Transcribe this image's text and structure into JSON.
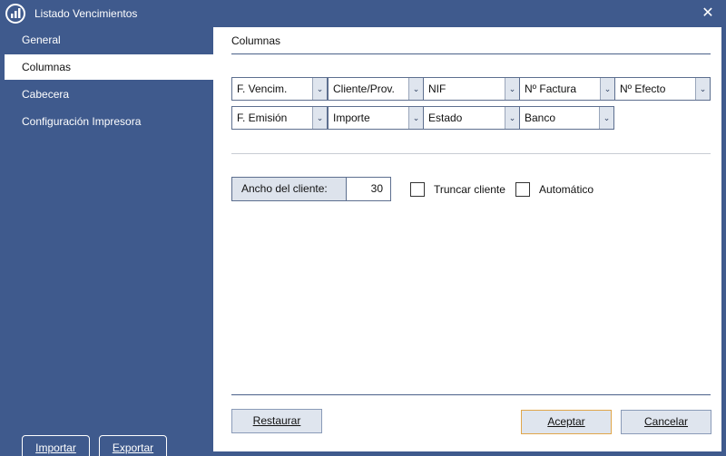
{
  "window": {
    "title": "Listado Vencimientos",
    "close_glyph": "✕",
    "icon": "bar-chart-logo-icon"
  },
  "sidebar": {
    "items": [
      {
        "label": "General",
        "active": false
      },
      {
        "label": "Columnas",
        "active": true
      },
      {
        "label": "Cabecera",
        "active": false
      },
      {
        "label": "Configuración Impresora",
        "active": false
      }
    ],
    "import_label": "Importar",
    "export_label": "Exportar"
  },
  "panel": {
    "title": "Columnas",
    "columns_row1": [
      "F. Vencim.",
      "Cliente/Prov.",
      "NIF",
      "Nº Factura",
      "Nº Efecto"
    ],
    "columns_row2": [
      "F. Emisión",
      "Importe",
      "Estado",
      "Banco"
    ],
    "client_width_label": "Ancho del cliente:",
    "client_width_value": "30",
    "truncate_label": "Truncar cliente",
    "automatic_label": "Automático",
    "restore_label": "Restaurar",
    "accept_label": "Aceptar",
    "cancel_label": "Cancelar",
    "dropdown_glyph": "⌄"
  },
  "colors": {
    "background": "#3f5a8d",
    "accent_focus": "#e0a64a"
  }
}
